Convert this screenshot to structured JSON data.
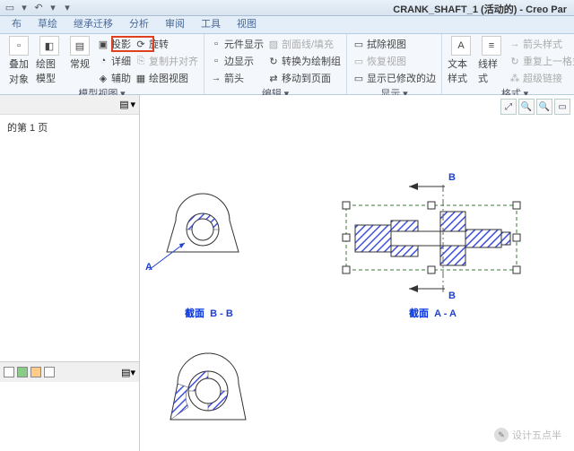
{
  "title": "CRANK_SHAFT_1 (活动的) - Creo Par",
  "tabs": [
    "布",
    "草绘",
    "继承迁移",
    "分析",
    "审阅",
    "工具",
    "视图"
  ],
  "ribbon": {
    "g1": {
      "b1": "叠加",
      "b2": "对象",
      "b3": "绘图模型",
      "b4": "常规",
      "label": "模型视图"
    },
    "g2": {
      "r1": "投影",
      "r2": "详细",
      "r3": "辅助",
      "r4": "旋转",
      "r5": "复制并对齐",
      "r6": "绘图视图"
    },
    "g3": {
      "r1": "元件显示",
      "r2": "边显示",
      "r3": "箭头",
      "r4": "剖面线/填充",
      "r5": "转换为绘制组",
      "r6": "移动到页面",
      "label": "编辑"
    },
    "g4": {
      "r1": "拭除视图",
      "r2": "恢复视图",
      "r3": "显示已修改的边",
      "label": "显示"
    },
    "g5": {
      "b1": "文本样式",
      "b2": "线样式",
      "r1": "箭头样式",
      "r2": "重复上一格式",
      "r3": "超级链接",
      "label": "格式"
    }
  },
  "sidepanel": {
    "page": "的第 1 页"
  },
  "canvas": {
    "sectBB": "截面",
    "bb": "B - B",
    "sectAA": "截面",
    "aa": "A - A",
    "labA": "A",
    "labB1": "B",
    "labB2": "B"
  },
  "wm": "设计五点半"
}
